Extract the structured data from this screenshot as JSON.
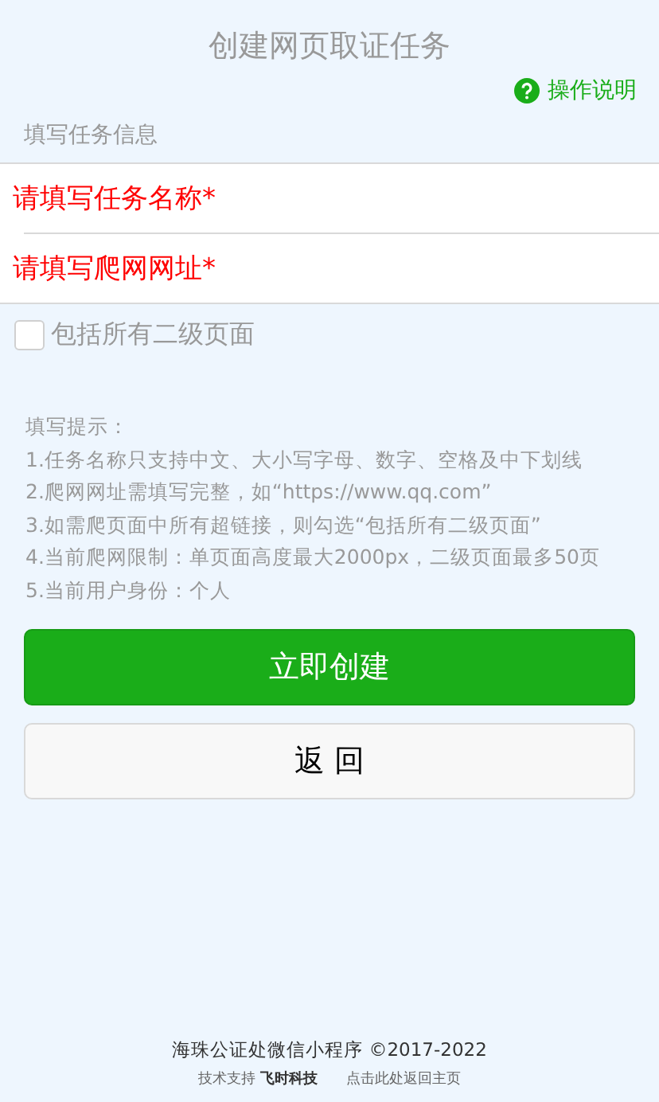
{
  "title": "创建网页取证任务",
  "help_link": "操作说明",
  "section_label": "填写任务信息",
  "fields": [
    {
      "placeholder": "请填写任务名称*"
    },
    {
      "placeholder": "请填写爬网网址*"
    }
  ],
  "checkbox": {
    "label": "包括所有二级页面",
    "checked": false
  },
  "tips": [
    "填写提示：",
    "1.任务名称只支持中文、大小写字母、数字、空格及中下划线",
    "2.爬网网址需填写完整，如“https://www.qq.com”",
    "3.如需爬页面中所有超链接，则勾选“包括所有二级页面”",
    "4.当前爬网限制：单页面高度最大2000px，二级页面最多50页",
    "5.当前用户身份：个人"
  ],
  "buttons": [
    {
      "label": "立即创建",
      "kind": "primary"
    },
    {
      "label": "返 回",
      "kind": "default"
    }
  ],
  "footer": {
    "copyright": "海珠公证处微信小程序 ©2017-2022",
    "support": "技术支持 **飞时科技**",
    "home_link": "点击此处返回主页"
  }
}
